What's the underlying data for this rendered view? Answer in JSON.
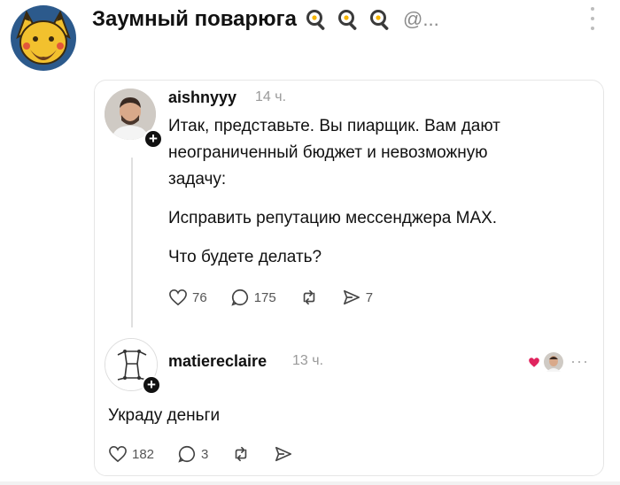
{
  "header": {
    "title": "Заумный поварюга",
    "handle": "@...",
    "icons": [
      "frying-pan-egg-icon",
      "frying-pan-egg-icon",
      "frying-pan-egg-icon"
    ]
  },
  "post": {
    "username": "aishnyyy",
    "time": "14 ч.",
    "lines": [
      "Итак, представьте. Вы пиарщик. Вам дают",
      "неограниченный бюджет и невозможную",
      "задачу:",
      "Исправить репутацию мессенджера MAX.",
      "Что будете делать?"
    ],
    "likes": "76",
    "comments": "175",
    "shares": "7"
  },
  "reply": {
    "username": "matiereclaire",
    "time": "13 ч.",
    "text": "Украду деньги",
    "likes": "182",
    "comments": "3",
    "menu": "···"
  },
  "colors": {
    "accent": "#111111",
    "muted": "#9a9a9a",
    "heart_red": "#e0245e"
  }
}
